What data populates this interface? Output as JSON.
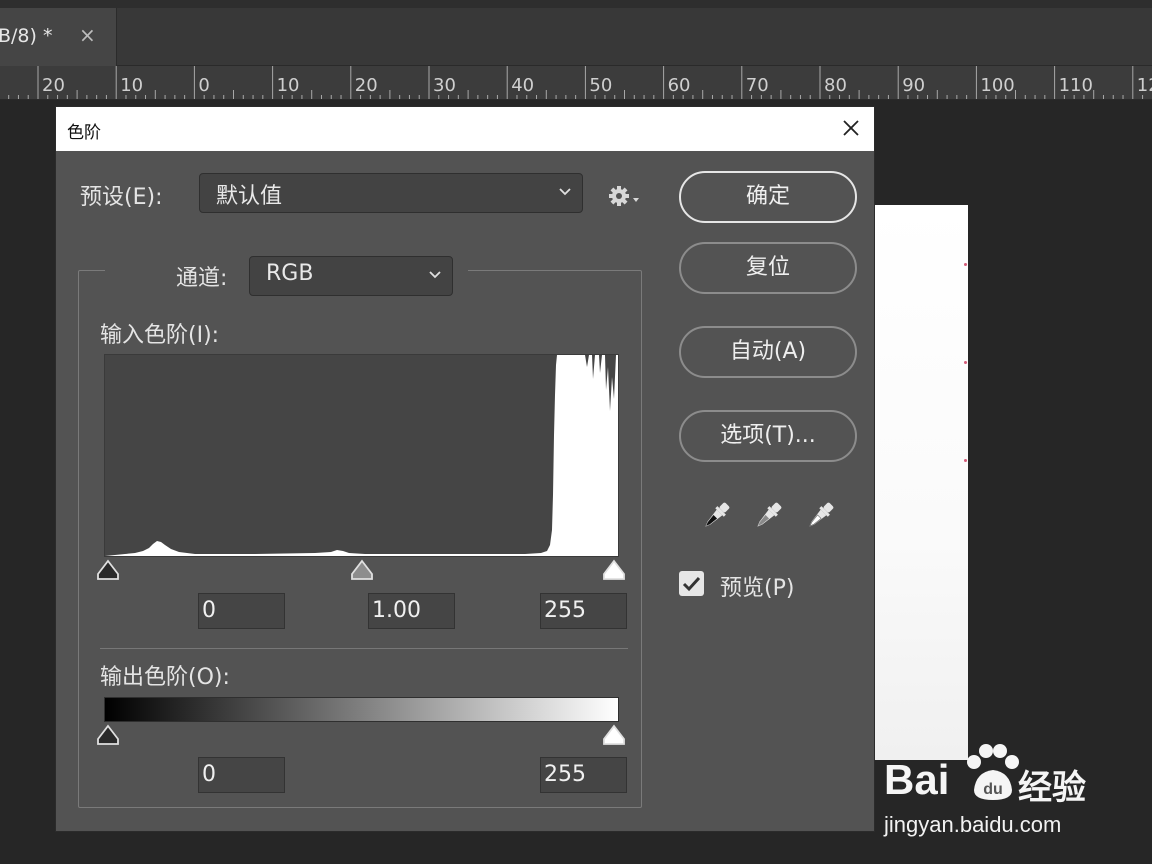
{
  "document_tab": {
    "label": "B/8) *",
    "close_glyph": "×"
  },
  "ruler": {
    "labels": [
      "20",
      "10",
      "0",
      "10",
      "20",
      "30",
      "40",
      "50",
      "60",
      "70",
      "80",
      "90",
      "100",
      "110",
      "12"
    ]
  },
  "dialog": {
    "title": "色阶",
    "preset_label": "预设(E):",
    "preset_value": "默认值",
    "channel_label": "通道:",
    "channel_value": "RGB",
    "input_levels_label": "输入色阶(I):",
    "output_levels_label": "输出色阶(O):",
    "input_black": "0",
    "input_gamma": "1.00",
    "input_white": "255",
    "output_black": "0",
    "output_white": "255",
    "buttons": {
      "ok": "确定",
      "reset": "复位",
      "auto": "自动(A)",
      "options": "选项(T)..."
    },
    "preview_label": "预览(P)",
    "preview_checked": true,
    "colors": {
      "panel": "#535353",
      "field": "#454545",
      "accent_text": "#e4e4e4"
    }
  },
  "watermark": {
    "brand": "Bai",
    "brand_suffix": "经验",
    "url": "jingyan.baidu.com"
  }
}
